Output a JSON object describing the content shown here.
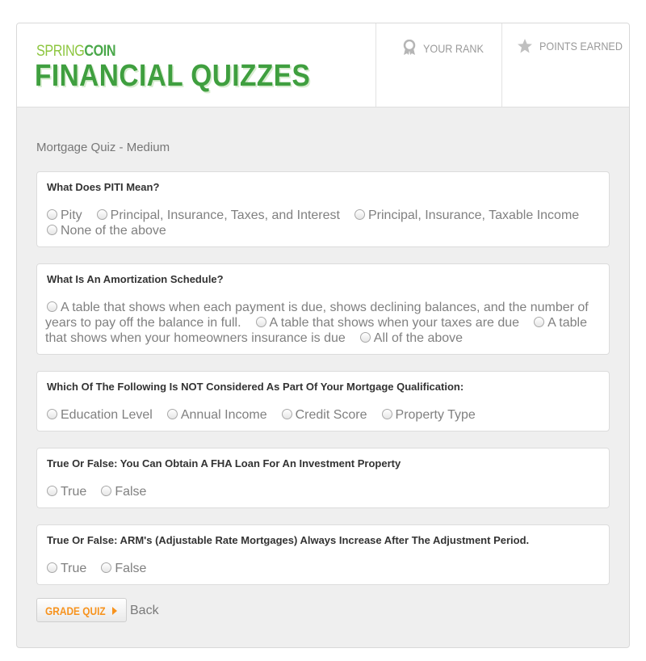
{
  "brand": {
    "small_prefix": "SPRING",
    "small_suffix": "COIN",
    "title": "FINANCIAL QUIZZES"
  },
  "header": {
    "rank_label": "YOUR RANK",
    "points_label": "POINTS EARNED"
  },
  "quiz_title": "Mortgage Quiz - Medium",
  "questions": [
    {
      "text": "What Does PITI Mean?",
      "options": [
        "Pity",
        "Principal, Insurance, Taxes, and Interest",
        "Principal, Insurance, Taxable Income",
        "None of the above"
      ]
    },
    {
      "text": "What Is An Amortization Schedule?",
      "options": [
        "A table that shows when each payment is due, shows declining balances, and the number of years to pay off the balance in full.",
        "A table that shows when your taxes are due",
        "A table that shows when your homeowners insurance is due",
        "All of the above"
      ]
    },
    {
      "text": "Which Of The Following Is NOT Considered As Part Of Your Mortgage Qualification:",
      "options": [
        "Education Level",
        "Annual Income",
        "Credit Score",
        "Property Type"
      ]
    },
    {
      "text": "True Or False: You Can Obtain A FHA Loan For An Investment Property",
      "options": [
        "True",
        "False"
      ]
    },
    {
      "text": "True Or False: ARM's (Adjustable Rate Mortgages) Always Increase After The Adjustment Period.",
      "options": [
        "True",
        "False"
      ]
    }
  ],
  "actions": {
    "grade_label": "GRADE QUIZ",
    "back_label": "Back"
  },
  "colors": {
    "brand_green": "#3f9f3f",
    "accent_orange": "#f7931e",
    "text_gray": "#808080"
  }
}
